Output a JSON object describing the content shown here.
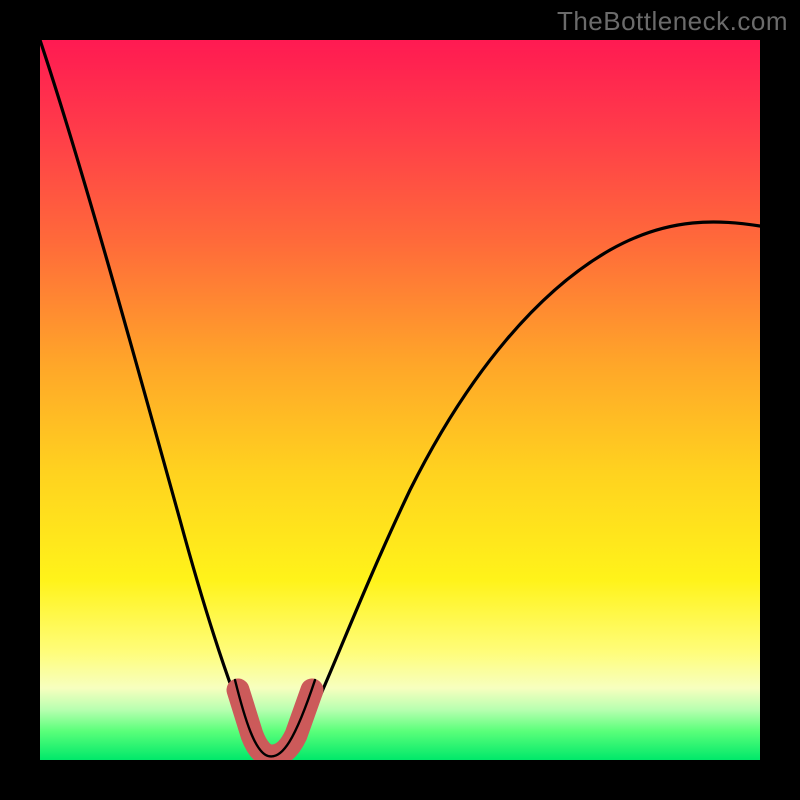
{
  "watermark": "TheBottleneck.com",
  "gradient_colors": {
    "top": "#ff1a52",
    "mid": "#ffd21f",
    "bottom": "#00e86a"
  },
  "chart_data": {
    "type": "line",
    "title": "",
    "xlabel": "",
    "ylabel": "",
    "xlim": [
      0,
      100
    ],
    "ylim": [
      0,
      100
    ],
    "series": [
      {
        "name": "bottleneck-curve",
        "x": [
          0,
          3,
          6,
          9,
          12,
          15,
          18,
          21,
          24,
          27,
          30,
          32,
          35,
          40,
          45,
          50,
          55,
          60,
          65,
          70,
          75,
          80,
          85,
          90,
          95,
          100
        ],
        "values": [
          100,
          90,
          80,
          70,
          60,
          50,
          40,
          30,
          20,
          10,
          3,
          0,
          3,
          10,
          18,
          26,
          33,
          40,
          46,
          52,
          57,
          62,
          66,
          69,
          72,
          74
        ]
      }
    ],
    "valley": {
      "x_range": [
        27,
        37
      ],
      "y_range": [
        0,
        10
      ]
    }
  }
}
